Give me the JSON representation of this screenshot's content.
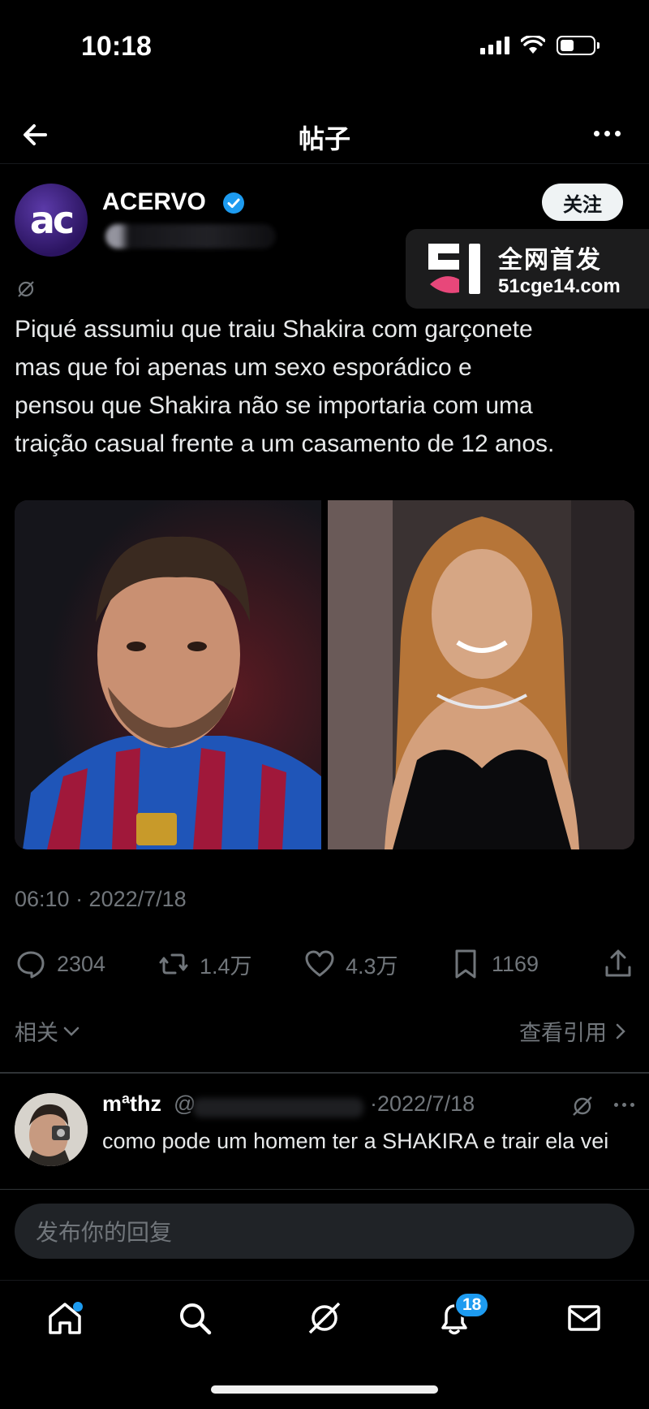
{
  "status_bar": {
    "time": "10:18"
  },
  "header": {
    "title": "帖子"
  },
  "post": {
    "author_name": "ACERVO",
    "avatar_text": "ac",
    "follow_label": "关注",
    "text": "Piqué assumiu que traiu Shakira com garçonete\nmas que foi apenas um sexo esporádico e\npensou que Shakira não se importaria com uma\ntraição casual frente a um casamento de 12 anos.",
    "timestamp": "06:10 · 2022/7/18",
    "stats": {
      "replies": "2304",
      "reposts": "1.4万",
      "likes": "4.3万",
      "bookmarks": "1169"
    },
    "related_label": "相关",
    "view_quotes_label": "查看引用"
  },
  "watermark": {
    "line1": "全网首发",
    "line2": "51cge14.com"
  },
  "reply": {
    "name": "mªthz",
    "handle_prefix": "@",
    "date": "·2022/7/18",
    "text": "como pode um homem ter a SHAKIRA e trair ela vei"
  },
  "compose": {
    "placeholder": "发布你的回复"
  },
  "nav": {
    "notifications_badge": "18"
  },
  "colors": {
    "accent": "#1d9bf0",
    "muted": "#71767b",
    "background": "#000000"
  }
}
